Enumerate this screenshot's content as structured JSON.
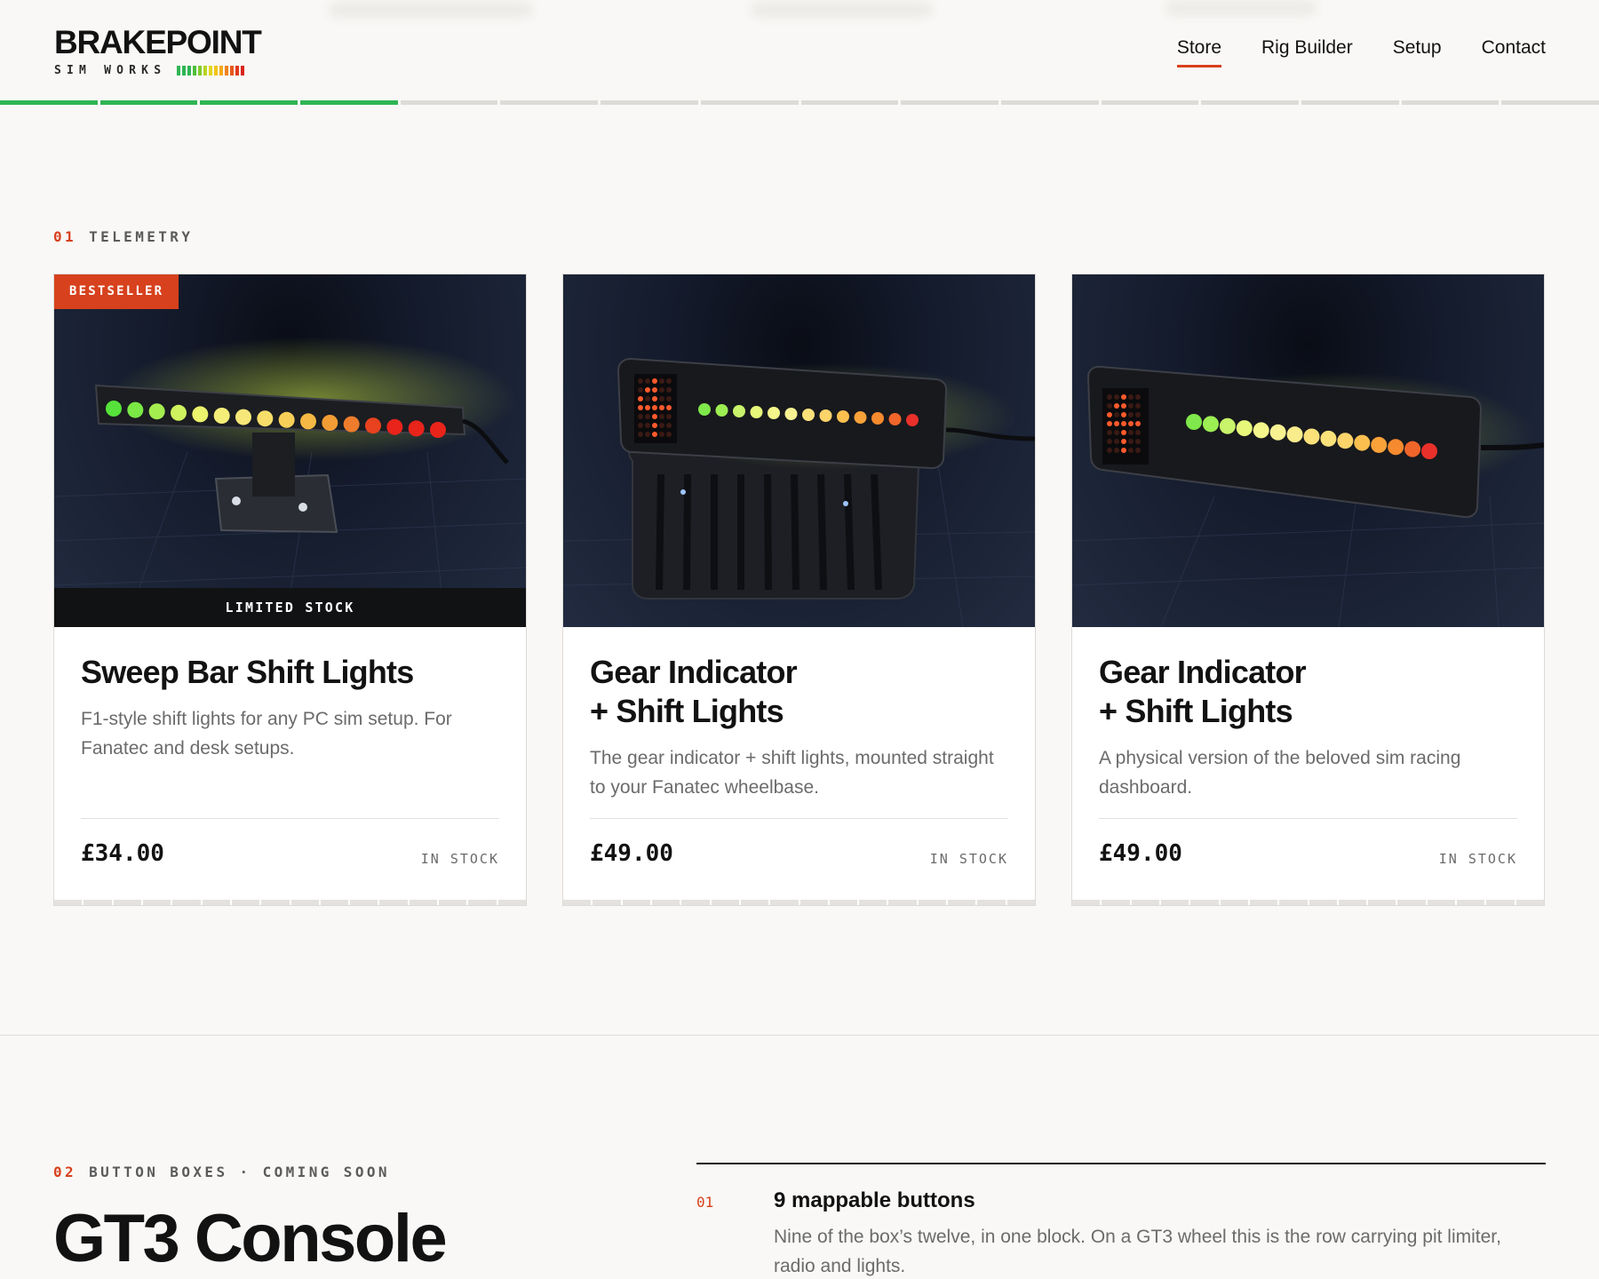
{
  "header": {
    "logo_title": "BRAKEPOINT",
    "logo_subtitle": "SIM WORKS",
    "logo_led_colors": [
      "#2fb553",
      "#2fb553",
      "#2fb553",
      "#4cbf3a",
      "#7fcb2b",
      "#b7d422",
      "#e3d51c",
      "#f2c41a",
      "#f5a81b",
      "#f0811c",
      "#e8581d",
      "#e03a1c",
      "#d8231b"
    ]
  },
  "nav": {
    "items": [
      {
        "label": "Store",
        "active": true
      },
      {
        "label": "Rig Builder",
        "active": false
      },
      {
        "label": "Setup",
        "active": false
      },
      {
        "label": "Contact",
        "active": false
      }
    ]
  },
  "progress": {
    "filled": 4,
    "total": 16,
    "fill_color": "#2fb553"
  },
  "section_telemetry": {
    "number": "01",
    "label": "TELEMETRY",
    "cards": [
      {
        "title": "Sweep Bar Shift Lights",
        "description": "F1-style shift lights for any PC sim setup. For Fanatec and desk setups.",
        "price": "£34.00",
        "stock": "IN STOCK",
        "badge_top": "BESTSELLER",
        "badge_bottom": "LIMITED STOCK",
        "image_icon": "sweep-bar-product-image"
      },
      {
        "title_line1": "Gear Indicator",
        "title_line2": "+ Shift Lights",
        "description": "The gear indicator + shift lights, mounted straight to your Fanatec wheelbase.",
        "price": "£49.00",
        "stock": "IN STOCK",
        "image_icon": "gear-indicator-wheelbase-product-image"
      },
      {
        "title_line1": "Gear Indicator",
        "title_line2": "+ Shift Lights",
        "description": "A physical version of the beloved sim racing dashboard.",
        "price": "£49.00",
        "stock": "IN STOCK",
        "image_icon": "gear-indicator-dash-product-image"
      }
    ]
  },
  "section_button_boxes": {
    "number": "02",
    "label": "BUTTON BOXES · COMING SOON",
    "title": "GT3 Console",
    "features": [
      {
        "number": "01",
        "title": "9 mappable buttons",
        "description": "Nine of the box’s twelve, in one block. On a GT3 wheel this is the row carrying pit limiter, radio and lights."
      }
    ]
  },
  "colors": {
    "accent": "#d7411d",
    "progress_green": "#2fb553",
    "background": "#f9f8f6"
  }
}
